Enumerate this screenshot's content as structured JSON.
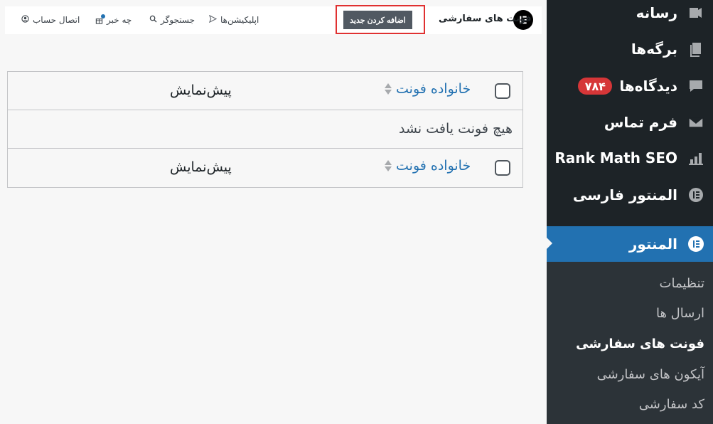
{
  "sidebar": {
    "items": [
      {
        "label": "رسانه",
        "icon": "media-icon"
      },
      {
        "label": "برگه‌ها",
        "icon": "pages-icon"
      },
      {
        "label": "دیدگاه‌ها",
        "icon": "comments-icon",
        "badge": "۷۸۴"
      },
      {
        "label": "فرم تماس",
        "icon": "mail-icon"
      },
      {
        "label": "Rank Math SEO",
        "icon": "chart-icon"
      },
      {
        "label": "المنتور فارسی",
        "icon": "elementor-persian-icon"
      }
    ],
    "active": {
      "label": "المنتور",
      "icon": "elementor-icon"
    },
    "submenu": [
      {
        "label": "تنظیمات"
      },
      {
        "label": "ارسال ها"
      },
      {
        "label": "فونت های سفارشی",
        "current": true
      },
      {
        "label": "آیکون های سفارشی"
      },
      {
        "label": "کد سفارشی"
      }
    ]
  },
  "topbar": {
    "title": "فونت های سفارشی",
    "add_new": "اضافه کردن جدید",
    "links": [
      {
        "label": "اپلیکیشن‌ها",
        "icon": "send-icon"
      },
      {
        "label": "جستجوگر",
        "icon": "search-icon"
      },
      {
        "label": "چه خبر",
        "icon": "gift-icon"
      },
      {
        "label": "اتصال حساب",
        "icon": "user-icon"
      }
    ]
  },
  "table": {
    "col_family": "خانواده فونت",
    "col_preview": "پیش‌نمایش",
    "empty": "هیچ فونت یافت نشد"
  },
  "colors": {
    "sidebar_bg": "#1d2327",
    "active_bg": "#2271b1",
    "badge_bg": "#d63638",
    "link": "#2271b1",
    "highlight": "#e03131"
  }
}
